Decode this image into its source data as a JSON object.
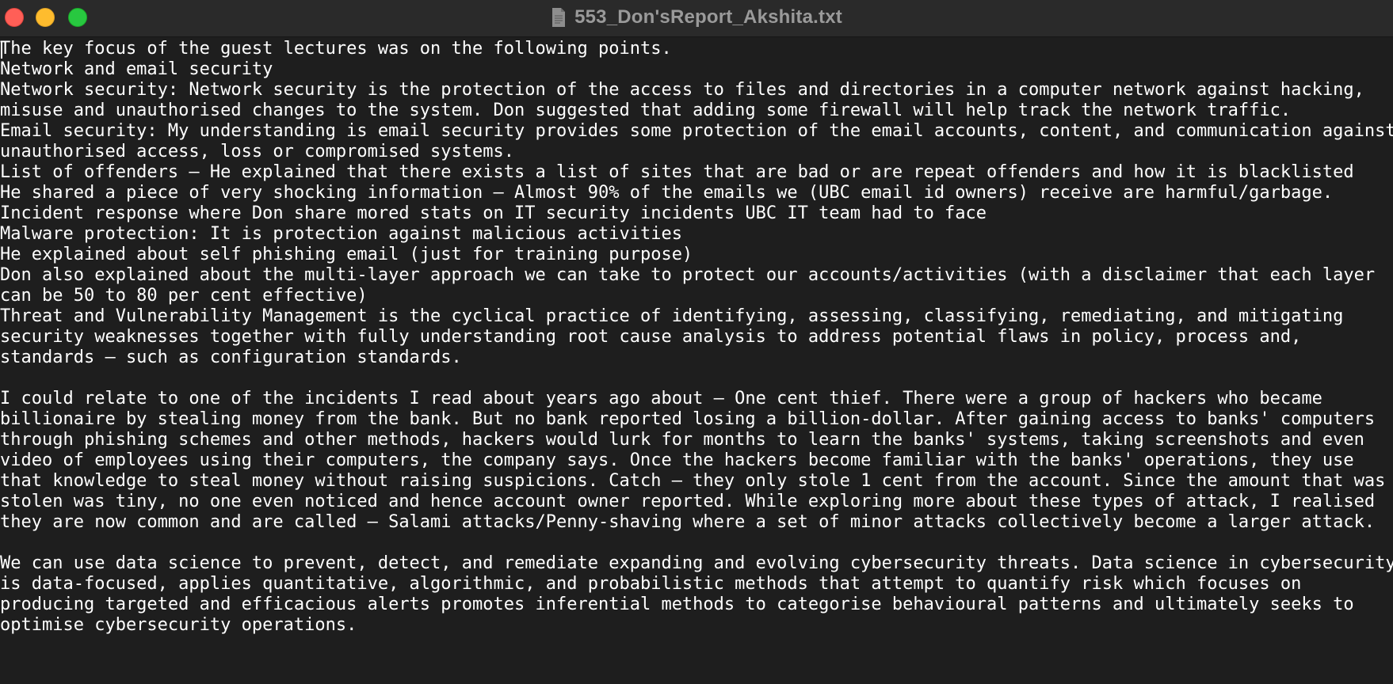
{
  "window": {
    "title": "553_Don'sReport_Akshita.txt",
    "colors": {
      "close": "#ff5f57",
      "minimize": "#febc2e",
      "zoom": "#28c840",
      "background": "#1e1e1e",
      "text": "#ffffff"
    },
    "icons": [
      "close-icon",
      "minimize-icon",
      "zoom-icon",
      "document-icon"
    ]
  },
  "document": {
    "lines": [
      "The key focus of the guest lectures was on the following points.",
      "Network and email security",
      "Network security: Network security is the protection of the access to files and directories in a computer network against hacking,",
      "misuse and unauthorised changes to the system. Don suggested that adding some firewall will help track the network traffic.",
      "Email security: My understanding is email security provides some protection of the email accounts, content, and communication against",
      "unauthorised access, loss or compromised systems.",
      "List of offenders – He explained that there exists a list of sites that are bad or are repeat offenders and how it is blacklisted",
      "He shared a piece of very shocking information – Almost 90% of the emails we (UBC email id owners) receive are harmful/garbage.",
      "Incident response where Don share mored stats on IT security incidents UBC IT team had to face",
      "Malware protection: It is protection against malicious activities",
      "He explained about self phishing email (just for training purpose)",
      "Don also explained about the multi-layer approach we can take to protect our accounts/activities (with a disclaimer that each layer",
      "can be 50 to 80 per cent effective)",
      "Threat and Vulnerability Management is the cyclical practice of identifying, assessing, classifying, remediating, and mitigating",
      "security weaknesses together with fully understanding root cause analysis to address potential flaws in policy, process and,",
      "standards – such as configuration standards.",
      "",
      "I could relate to one of the incidents I read about years ago about – One cent thief. There were a group of hackers who became",
      "billionaire by stealing money from the bank. But no bank reported losing a billion-dollar. After gaining access to banks' computers",
      "through phishing schemes and other methods, hackers would lurk for months to learn the banks' systems, taking screenshots and even",
      "video of employees using their computers, the company says. Once the hackers become familiar with the banks' operations, they use",
      "that knowledge to steal money without raising suspicions. Catch – they only stole 1 cent from the account. Since the amount that was",
      "stolen was tiny, no one even noticed and hence account owner reported. While exploring more about these types of attack, I realised",
      "they are now common and are called – Salami attacks/Penny-shaving where a set of minor attacks collectively become a larger attack.",
      "",
      "We can use data science to prevent, detect, and remediate expanding and evolving cybersecurity threats. Data science in cybersecurity",
      "is data-focused, applies quantitative, algorithmic, and probabilistic methods that attempt to quantify risk which focuses on",
      "producing targeted and efficacious alerts promotes inferential methods to categorise behavioural patterns and ultimately seeks to",
      "optimise cybersecurity operations."
    ]
  }
}
